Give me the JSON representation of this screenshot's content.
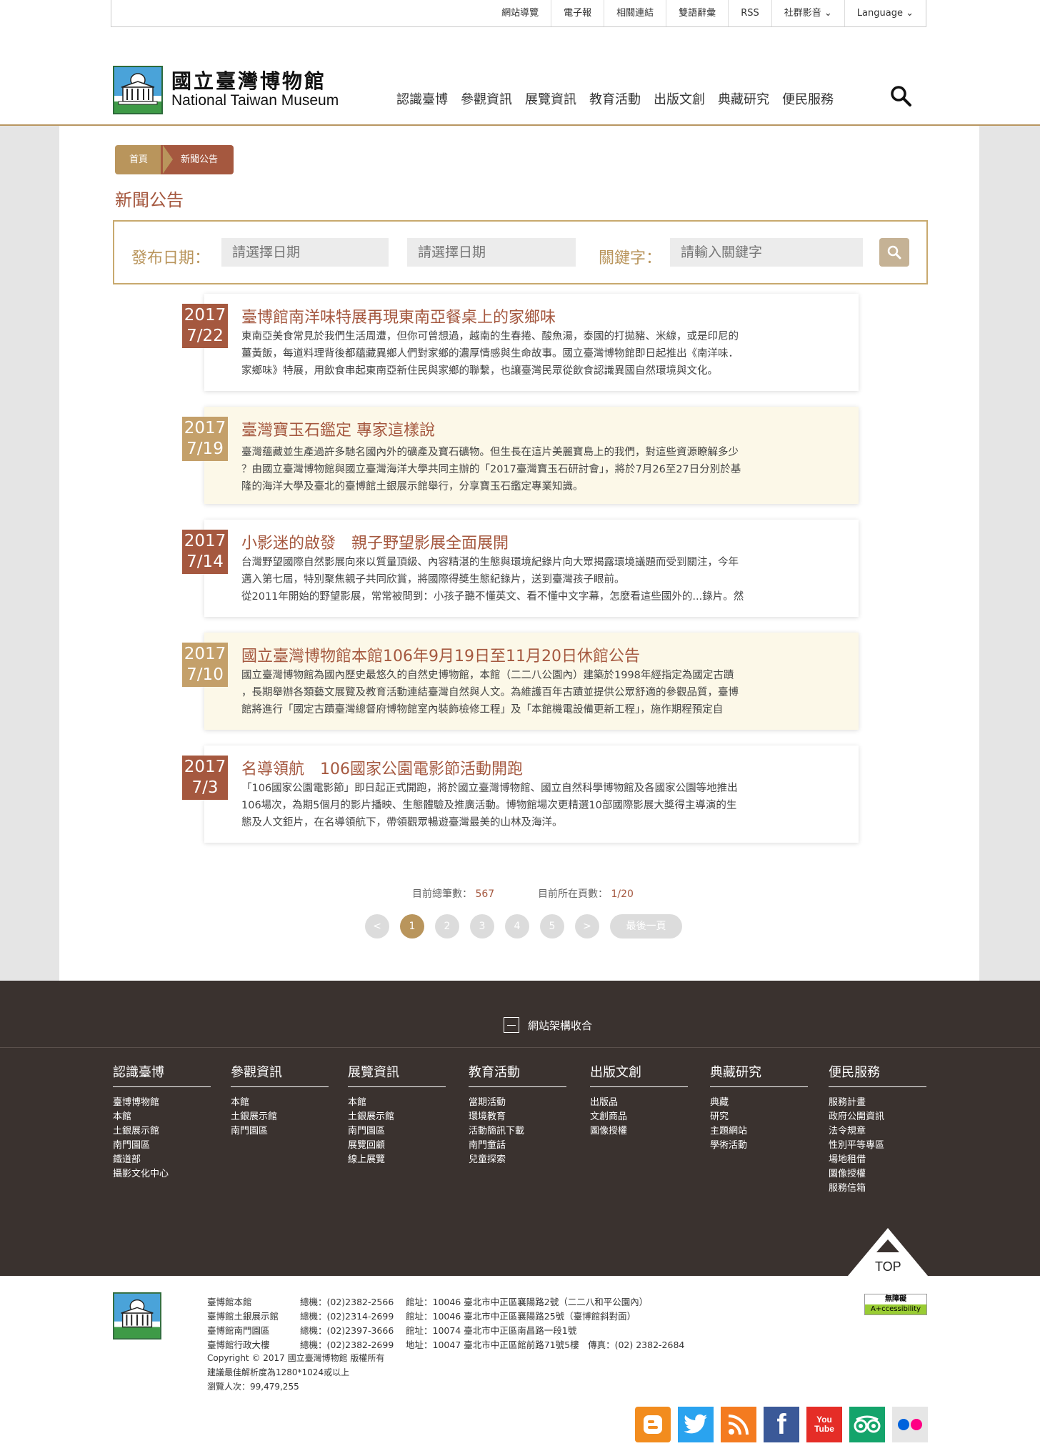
{
  "topbar": {
    "items": [
      "網站導覽",
      "電子報",
      "相關連結",
      "雙語辭彙",
      "RSS",
      "社群影音",
      "Language"
    ]
  },
  "logo": {
    "name_zh": "國立臺灣博物館",
    "name_en": "National Taiwan Museum"
  },
  "mainnav": [
    "認識臺博",
    "參觀資訊",
    "展覽資訊",
    "教育活動",
    "出版文創",
    "典藏研究",
    "便民服務"
  ],
  "breadcrumb": {
    "home": "首頁",
    "current": "新聞公告"
  },
  "page_title": "新聞公告",
  "filter": {
    "date_label": "發布日期：",
    "date_start_placeholder": "請選擇日期",
    "date_end_placeholder": "請選擇日期",
    "keyword_label": "關鍵字：",
    "keyword_placeholder": "請輸入關鍵字"
  },
  "news": [
    {
      "year": "2017",
      "md": "7/22",
      "title": "臺博館南洋味特展再現東南亞餐桌上的家鄉味",
      "lines": [
        "東南亞美食常見於我們生活周遭，但你可曾想過，越南的生春捲、酸魚湯，泰國的打拋豬、米線，或是印尼的",
        "薑黃飯，每道料理背後都蘊藏異鄉人們對家鄉的濃厚情感與生命故事。國立臺灣博物館即日起推出《南洋味．",
        "家鄉味》特展，用飲食串起東南亞新住民與家鄉的聯繫，也讓臺灣民眾從飲食認識異國自然環境與文化。"
      ]
    },
    {
      "year": "2017",
      "md": "7/19",
      "title": "臺灣寶玉石鑑定 專家這樣說",
      "lines": [
        "臺灣蘊藏並生產過許多馳名國內外的礦產及寶石礦物。但生長在這片美麗寶島上的我們，對這些資源瞭解多少",
        "？由國立臺灣博物館與國立臺灣海洋大學共同主辦的「2017臺灣寶玉石研討會」，將於7月26至27日分別於基",
        "隆的海洋大學及臺北的臺博館土銀展示館舉行，分享寶玉石鑑定專業知識。"
      ]
    },
    {
      "year": "2017",
      "md": "7/14",
      "title": "小影迷的啟發　親子野望影展全面展開",
      "lines": [
        "台灣野望國際自然影展向來以質量頂級、內容精湛的生態與環境紀錄片向大眾揭露環境議題而受到關注，今年",
        "邁入第七屆，特別聚焦親子共同欣賞，將國際得獎生態紀錄片，送到臺灣孩子眼前。",
        "從2011年開始的野望影展，常常被問到：小孩子聽不懂英文、看不懂中文字幕，怎麼看這些國外的...錄片。然"
      ]
    },
    {
      "year": "2017",
      "md": "7/10",
      "title": "國立臺灣博物館本館106年9月19日至11月20日休館公告",
      "lines": [
        "國立臺灣博物館為國內歷史最悠久的自然史博物館，本館（二二八公園內）建築於1998年經指定為國定古蹟",
        "，長期舉辦各類藝文展覽及教育活動連結臺灣自然與人文。為維護百年古蹟並提供公眾舒適的參觀品質，臺博",
        "館將進行「國定古蹟臺灣總督府博物館室內裝飾檢修工程」及「本館機電設備更新工程」，施作期程預定自"
      ]
    },
    {
      "year": "2017",
      "md": "7/3",
      "title": "名導領航　106國家公園電影節活動開跑",
      "lines": [
        "「106國家公園電影節」即日起正式開跑，將於國立臺灣博物館、國立自然科學博物館及各國家公園等地推出",
        "106場次，為期5個月的影片播映、生態體驗及推廣活動。博物館場次更精選10部國際影展大獎得主導演的生",
        "態及人文鉅片，在名導領航下，帶領觀眾暢遊臺灣最美的山林及海洋。"
      ]
    }
  ],
  "stats": {
    "total_label": "目前總筆數：",
    "total": "567",
    "page_label": "目前所在頁數：",
    "page": "1/20"
  },
  "pager": {
    "prev": "<",
    "pages": [
      "1",
      "2",
      "3",
      "4",
      "5"
    ],
    "next": ">",
    "last": "最後一頁"
  },
  "footer": {
    "collapse_label": "網站架構收合",
    "columns": [
      {
        "title": "認識臺博",
        "items": [
          "臺博博物館",
          "本館",
          "土銀展示館",
          "南門園區",
          "鐵道部",
          "攝影文化中心"
        ]
      },
      {
        "title": "參觀資訊",
        "items": [
          "本館",
          "土銀展示館",
          "南門園區"
        ]
      },
      {
        "title": "展覽資訊",
        "items": [
          "本館",
          "土銀展示館",
          "南門園區",
          "展覽回顧",
          "線上展覽"
        ]
      },
      {
        "title": "教育活動",
        "items": [
          "當期活動",
          "環境教育",
          "活動簡訊下載",
          "南門童話",
          "兒童探索"
        ]
      },
      {
        "title": "出版文創",
        "items": [
          "出版品",
          "文創商品",
          "圖像授權"
        ]
      },
      {
        "title": "典藏研究",
        "items": [
          "典藏",
          "研究",
          "主題網站",
          "學術活動"
        ]
      },
      {
        "title": "便民服務",
        "items": [
          "服務計畫",
          "政府公開資訊",
          "法令規章",
          "性別平等專區",
          "場地租借",
          "圖像授權",
          "服務信箱"
        ]
      }
    ],
    "top_label": "TOP",
    "contacts": [
      {
        "name": "臺博館本館",
        "tel": "總機：(02)2382-2566",
        "addr": "館址：10046 臺北市中正區襄陽路2號（二二八和平公園內）"
      },
      {
        "name": "臺博館土銀展示館",
        "tel": "總機：(02)2314-2699",
        "addr": "館址：10046 臺北市中正區襄陽路25號（臺博館斜對面）"
      },
      {
        "name": "臺博館南門園區",
        "tel": "總機：(02)2397-3666",
        "addr": "館址：10074 臺北市中正區南昌路一段1號"
      },
      {
        "name": "臺博館行政大樓",
        "tel": "總機：(02)2382-2699",
        "addr": "地址：10047 臺北市中正區館前路71號5樓　傳真：(02) 2382-2684"
      }
    ],
    "copyright": "Copyright © 2017  國立臺灣博物館 版權所有",
    "resolution": "建議最佳解析度為1280*1024或以上",
    "visitors": "瀏覽人次：99,479,255",
    "access_badge_top": "無障礙",
    "access_badge_bottom": "A+ccessibility",
    "social_icons": [
      "blogger-icon",
      "twitter-icon",
      "rss-icon",
      "facebook-icon",
      "youtube-icon",
      "tripadvisor-icon",
      "flickr-icon"
    ],
    "youtube_text": "You Tube"
  },
  "colors": {
    "brand_red": "#a5583f",
    "brand_gold": "#b9955c",
    "footer_bg": "#3a322f"
  }
}
